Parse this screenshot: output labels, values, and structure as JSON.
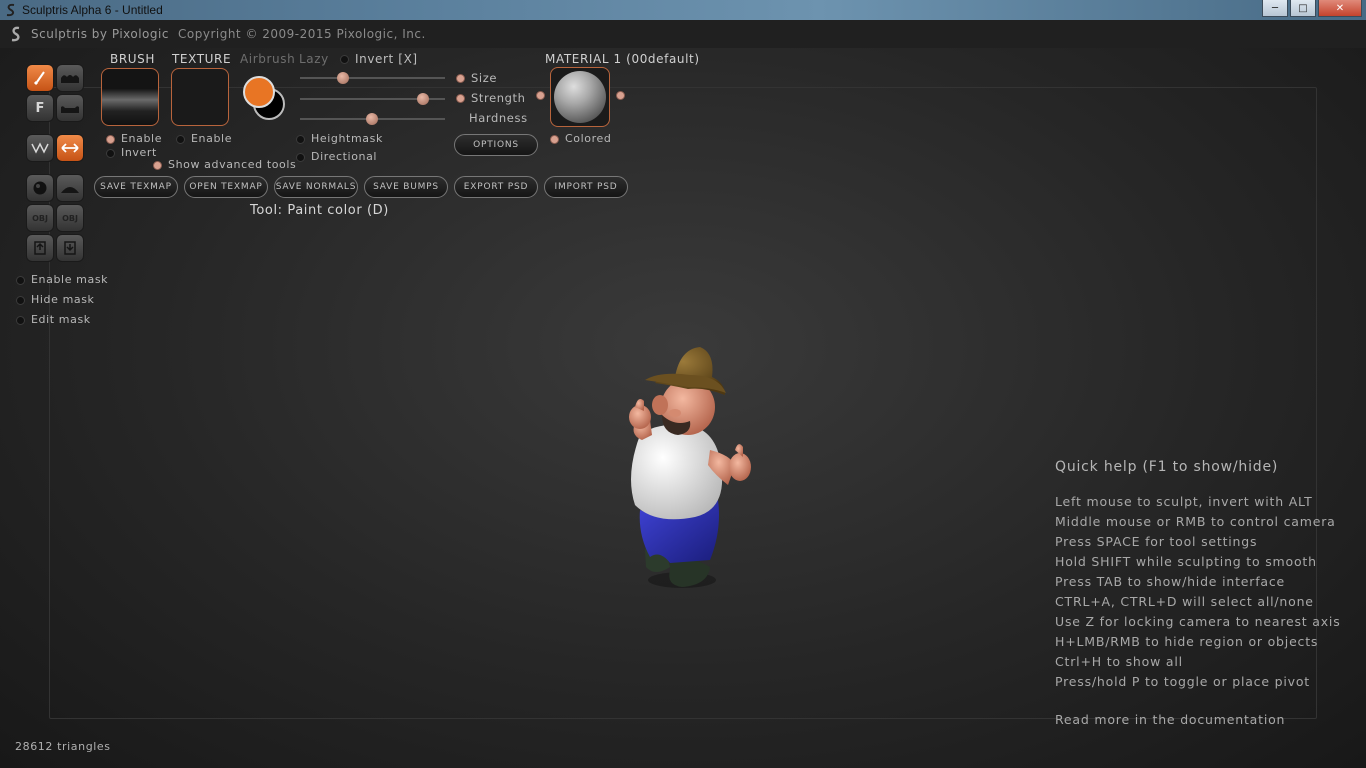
{
  "window": {
    "title": "Sculptris Alpha 6 - Untitled",
    "controls": [
      "minimize",
      "maximize",
      "close"
    ]
  },
  "menubar": {
    "brand": "Sculptris by Pixologic",
    "copyright": "Copyright © 2009-2015 Pixologic, Inc."
  },
  "toolbar": {
    "brush_label": "BRUSH",
    "texture_label": "TEXTURE",
    "airbrush_label": "Airbrush",
    "lazy_label": "Lazy",
    "invert_label": "Invert [X]",
    "brush_enable": "Enable",
    "brush_invert": "Invert",
    "texture_enable": "Enable",
    "show_advanced": "Show advanced tools",
    "heightmask": "Heightmask",
    "directional": "Directional",
    "size_label": "Size",
    "strength_label": "Strength",
    "hardness_label": "Hardness",
    "size_value": 0.3,
    "strength_value": 0.85,
    "hardness_value": 0.5,
    "options_label": "OPTIONS",
    "material_label": "MATERIAL 1 (00default)",
    "colored_label": "Colored",
    "paint_color": "#e87524",
    "secondary_color": "#000000",
    "buttons": [
      "SAVE TEXMAP",
      "OPEN TEXMAP",
      "SAVE NORMALS",
      "SAVE BUMPS",
      "EXPORT PSD",
      "IMPORT PSD"
    ],
    "tool_status": "Tool: Paint color (D)"
  },
  "left_tools": {
    "icons": [
      "paint-brush-icon",
      "bump-icon",
      "f-icon",
      "flatten-icon",
      "mirror-icon",
      "symmetry-arrows-icon",
      "sphere-icon",
      "plane-icon",
      "import-obj-icon",
      "export-obj-icon",
      "save-file-icon",
      "open-file-icon"
    ],
    "f_label": "F",
    "obj_label": "OBJ"
  },
  "mask_options": {
    "enable": "Enable mask",
    "hide": "Hide mask",
    "edit": "Edit mask"
  },
  "quick_help": {
    "title": "Quick help (F1 to show/hide)",
    "lines": [
      "Left mouse to sculpt, invert with ALT",
      "Middle mouse or RMB to control camera",
      "Press SPACE for tool settings",
      "Hold SHIFT while sculpting to smooth",
      "Press TAB to show/hide interface",
      "CTRL+A, CTRL+D will select all/none",
      "Use Z for locking camera to nearest axis",
      "H+LMB/RMB to hide region or objects",
      "Ctrl+H to show all",
      "Press/hold P to toggle or place pivot"
    ],
    "more": "Read more in the documentation"
  },
  "status": {
    "triangles": "28612 triangles"
  },
  "colors": {
    "accent": "#e87524",
    "background": "#262626"
  }
}
